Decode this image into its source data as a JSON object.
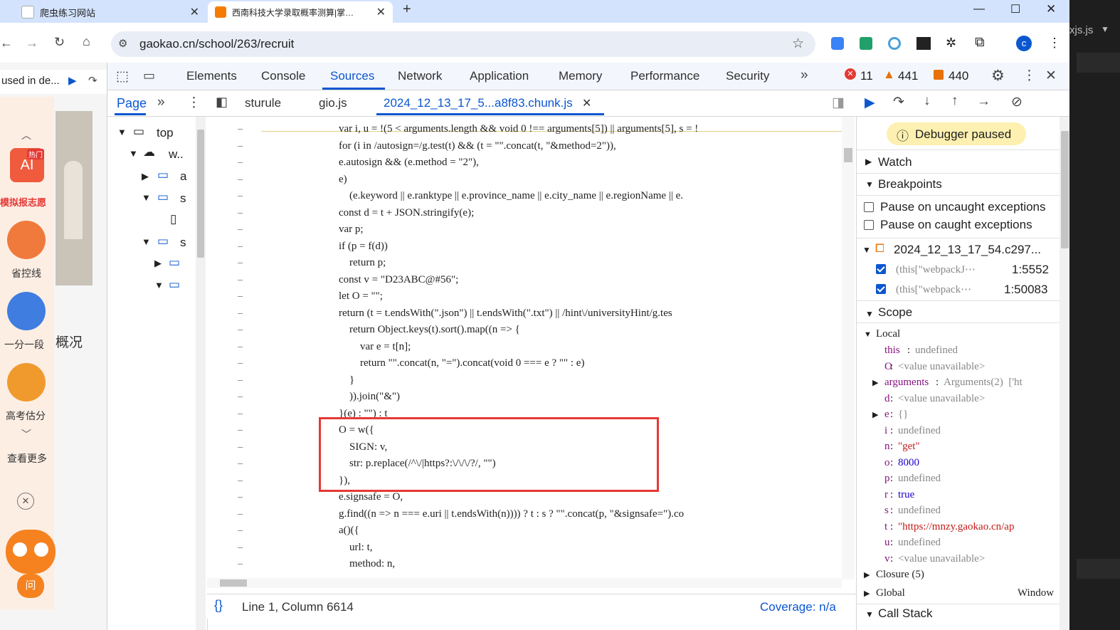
{
  "browser": {
    "tabs": [
      {
        "title": "爬虫练习网站",
        "active": false
      },
      {
        "title": "西南科技大学录取概率测算|掌…",
        "active": true
      }
    ],
    "new_tab": "+",
    "url": "gaokao.cn/school/263/recruit",
    "profile_letter": "c",
    "window_title_fragment": "xjs.js"
  },
  "webpage": {
    "banner_text": "used in de...",
    "side_items": [
      "模拟报志愿",
      "省控线",
      "一分一段",
      "高考估分",
      "查看更多"
    ],
    "hot_badge": "热门",
    "section_title": "概况",
    "mascot_label": "问"
  },
  "devtools": {
    "tabs": [
      "Elements",
      "Console",
      "Sources",
      "Network",
      "Application",
      "Memory",
      "Performance",
      "Security"
    ],
    "active_tab": "Sources",
    "errors": "11",
    "warnings": "441",
    "issues": "440",
    "sub": {
      "page_tab": "Page",
      "files": [
        "sturule",
        "gio.js",
        "2024_12_13_17_5...a8f83.chunk.js"
      ]
    },
    "navigator": {
      "items": [
        "top",
        "w..",
        "a",
        "s",
        "s"
      ]
    },
    "code_lines": [
      "var i, u = !(5 < arguments.length && void 0 !== arguments[5]) || arguments[5], s = !",
      "for (i in /autosign=/g.test(t) && (t = \"\".concat(t, \"&method=2\")),",
      "e.autosign && (e.method = \"2\"),",
      "e)",
      "    (e.keyword || e.ranktype || e.province_name || e.city_name || e.regionName || e.",
      "const d = t + JSON.stringify(e);",
      "var p;",
      "if (p = f(d))",
      "    return p;",
      "const v = \"D23ABC@#56\";",
      "let O = \"\";",
      "return (t = t.endsWith(\".json\") || t.endsWith(\".txt\") || /hint\\/universityHint/g.tes",
      "    return Object.keys(t).sort().map((n => {",
      "        var e = t[n];",
      "        return \"\".concat(n, \"=\").concat(void 0 === e ? \"\" : e)",
      "    }",
      "    )).join(\"&\")",
      "}(e) : \"\") : t",
      "O = w({",
      "    SIGN: v,",
      "    str: p.replace(/^\\/|https?:\\/\\/\\/?/, \"\")",
      "}),",
      "e.signsafe = O,",
      "g.find((n => n === e.uri || t.endsWith(n)))) ? t : s ? \"\".concat(p, \"&signsafe=\").co",
      "a()({",
      "    url: t,",
      "    method: n,"
    ],
    "status": {
      "position": "Line 1, Column 6614",
      "coverage": "Coverage: n/a"
    },
    "debugger": {
      "paused_label": "Debugger paused",
      "watch": "Watch",
      "breakpoints": "Breakpoints",
      "pause_uncaught": "Pause on uncaught exceptions",
      "pause_caught": "Pause on caught exceptions",
      "bp_file": "2024_12_13_17_54.c297...",
      "bp_entries": [
        {
          "code": "(this[\"webpackJ⋯",
          "loc": "1:5552"
        },
        {
          "code": "(this[\"webpack⋯",
          "loc": "1:50083"
        }
      ],
      "scope": "Scope",
      "local": "Local",
      "vars": [
        {
          "k": "this",
          "v": "undefined",
          "t": "u"
        },
        {
          "k": "O",
          "v": "<value unavailable>",
          "t": "u"
        },
        {
          "k": "arguments",
          "v": "Arguments(2)  ['ht",
          "t": "u"
        },
        {
          "k": "d",
          "v": "<value unavailable>",
          "t": "u"
        },
        {
          "k": "e",
          "v": "{}",
          "t": "u"
        },
        {
          "k": "i",
          "v": "undefined",
          "t": "u"
        },
        {
          "k": "n",
          "v": "\"get\"",
          "t": "s"
        },
        {
          "k": "o",
          "v": "8000",
          "t": "n"
        },
        {
          "k": "p",
          "v": "undefined",
          "t": "u"
        },
        {
          "k": "r",
          "v": "true",
          "t": "n"
        },
        {
          "k": "s",
          "v": "undefined",
          "t": "u"
        },
        {
          "k": "t",
          "v": "\"https://mnzy.gaokao.cn/ap",
          "t": "s"
        },
        {
          "k": "u",
          "v": "undefined",
          "t": "u"
        },
        {
          "k": "v",
          "v": "<value unavailable>",
          "t": "u"
        }
      ],
      "closure": "Closure (5)",
      "global": "Global",
      "global_val": "Window",
      "call_stack": "Call Stack"
    }
  },
  "colors": {
    "accent": "#0b57d0",
    "highlight_box": "#e53935"
  }
}
